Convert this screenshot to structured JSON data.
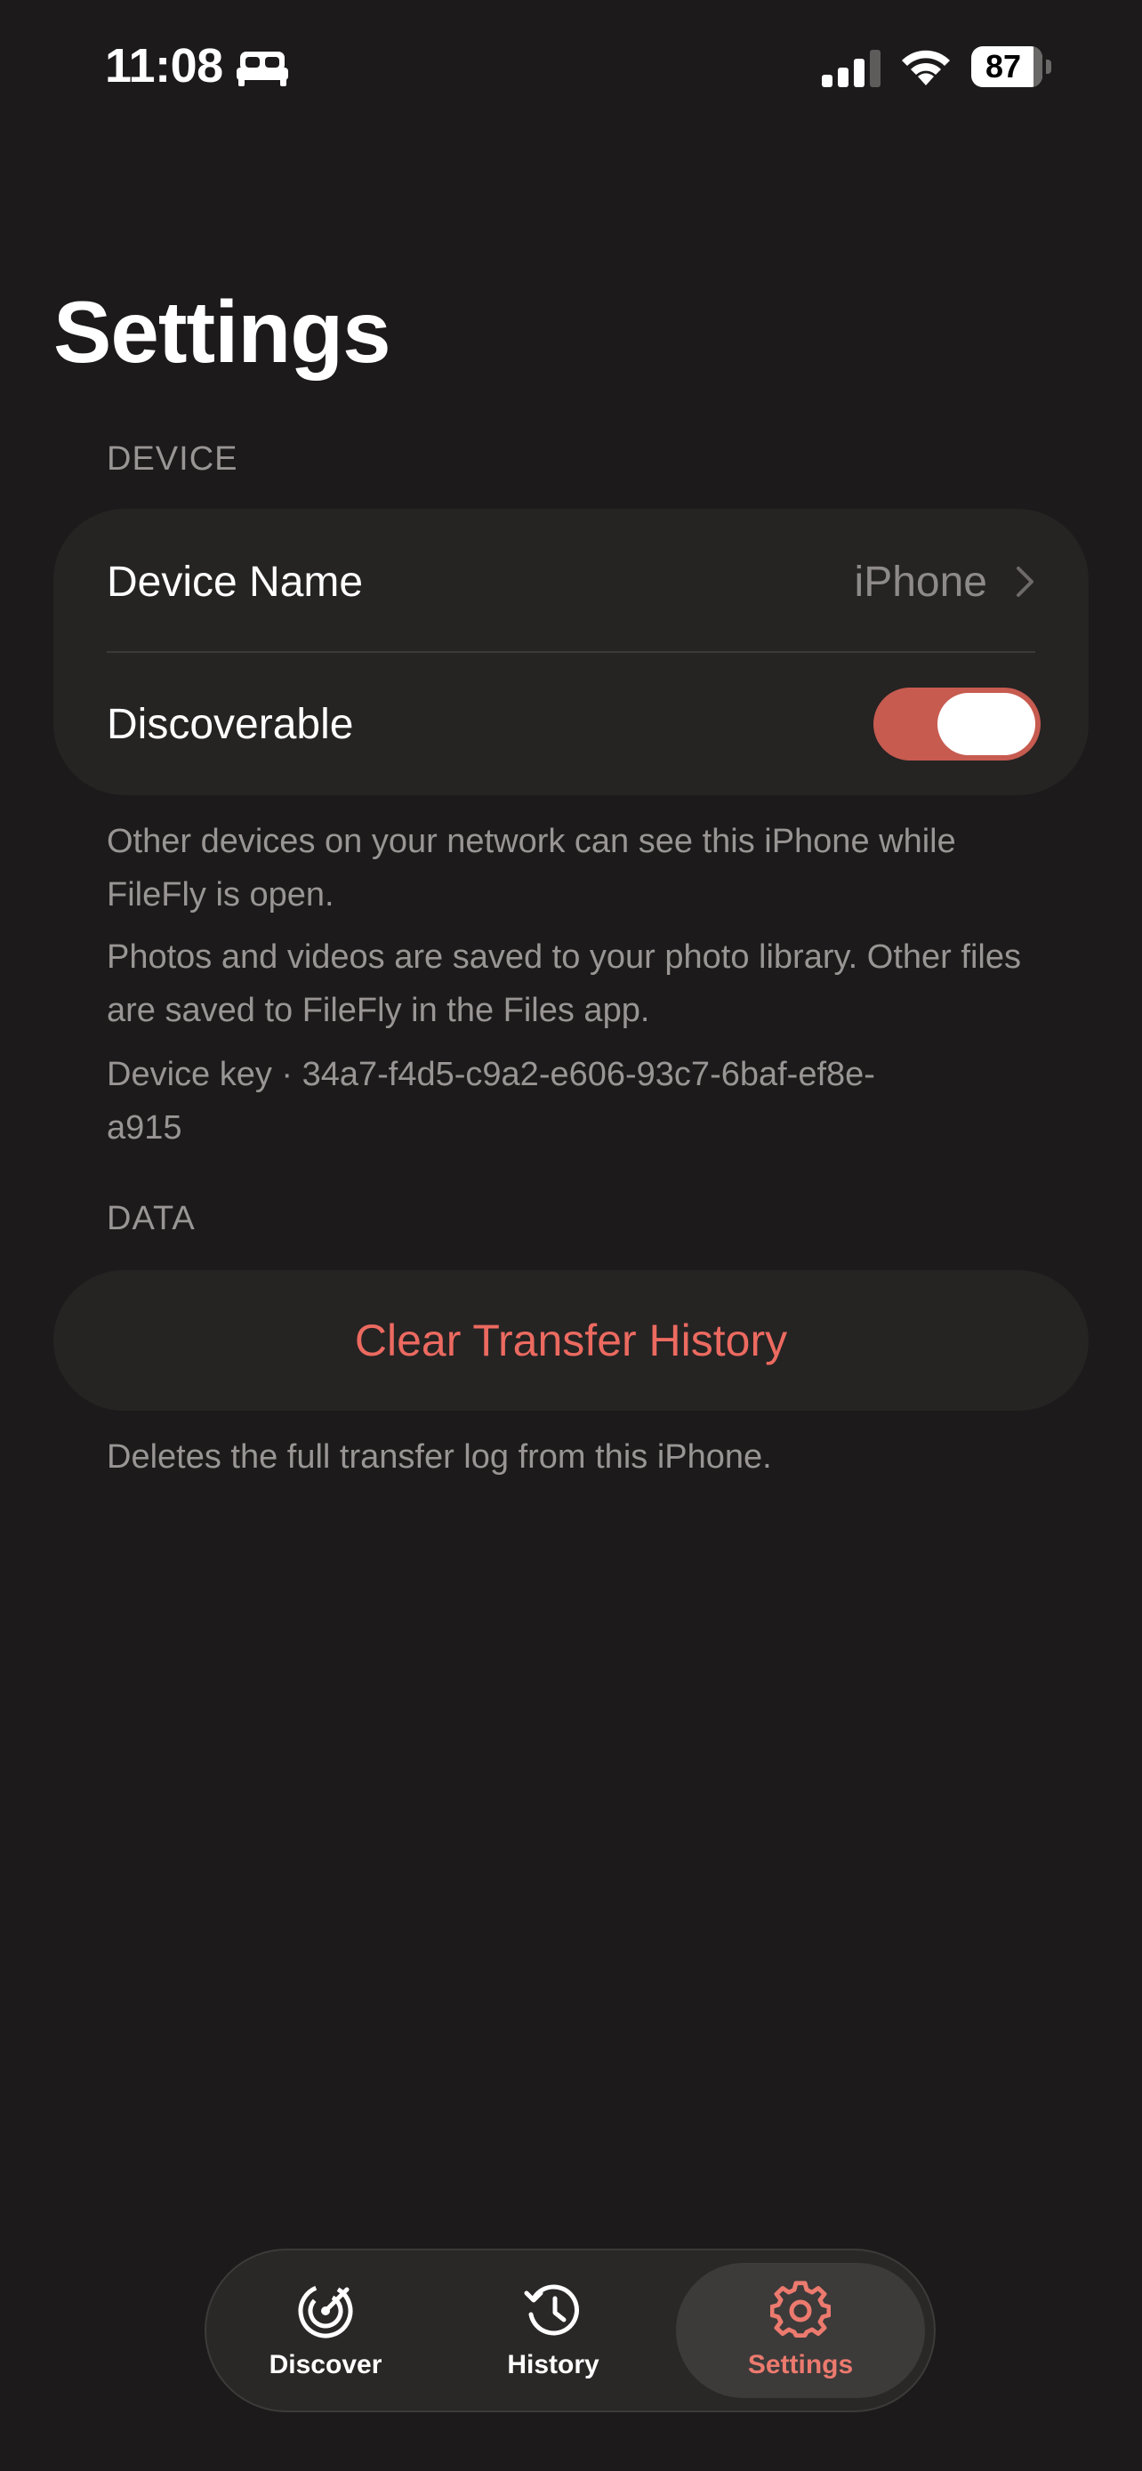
{
  "status_bar": {
    "time": "11:08",
    "battery_percent": "87",
    "battery_level": 0.87,
    "icons": [
      "bed-icon",
      "cellular-signal-icon",
      "wifi-icon",
      "battery-icon"
    ]
  },
  "page": {
    "title": "Settings"
  },
  "device_section": {
    "header": "DEVICE",
    "device_name_label": "Device Name",
    "device_name_value": "iPhone",
    "discoverable_label": "Discoverable",
    "discoverable_on": true,
    "note_discoverable": "Other devices on your network can see this iPhone while FileFly is open.",
    "note_storage": "Photos and videos are saved to your photo library. Other files are saved to FileFly in the Files app.",
    "note_device_key": "Device key · 34a7-f4d5-c9a2-e606-93c7-6baf-ef8e-a915"
  },
  "data_section": {
    "header": "DATA",
    "clear_history_label": "Clear Transfer History",
    "clear_history_note": "Deletes the full transfer log from this iPhone."
  },
  "tab_bar": {
    "tabs": [
      {
        "label": "Discover",
        "icon": "radar-icon"
      },
      {
        "label": "History",
        "icon": "history-icon"
      },
      {
        "label": "Settings",
        "icon": "gear-icon",
        "active": true
      }
    ]
  },
  "colors": {
    "background": "#1c1a1a",
    "card": "#262323",
    "accent": "#ec6a60",
    "toggle_on": "#c75b50",
    "secondary_text": "#9a9595"
  }
}
